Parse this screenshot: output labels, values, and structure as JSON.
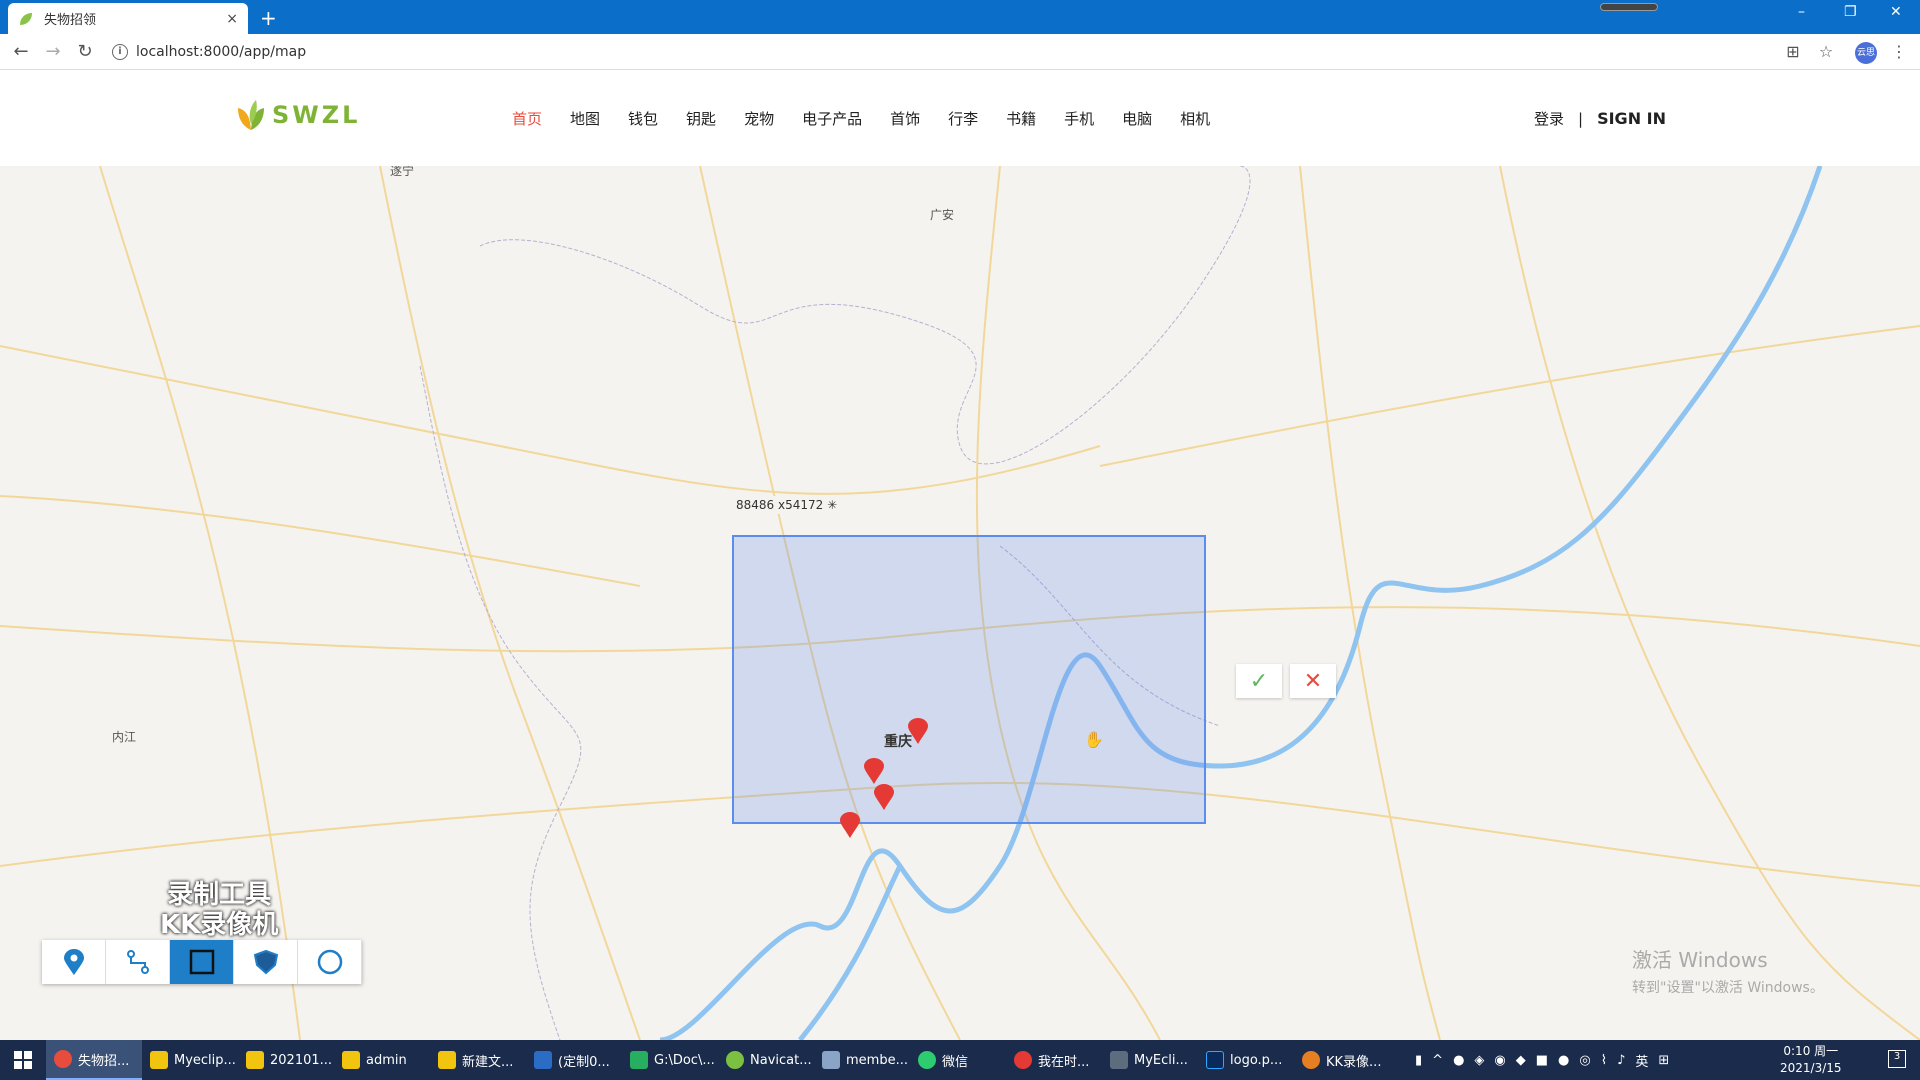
{
  "browser": {
    "tab_title": "失物招领",
    "url": "localhost:8000/app/map",
    "new_tab": "+",
    "tab_close": "×",
    "win_min": "–",
    "win_restore": "❐",
    "win_close": "✕",
    "avatar_text": "云思"
  },
  "site": {
    "logo_text": "SWZL",
    "nav": [
      "首页",
      "地图",
      "钱包",
      "钥匙",
      "宠物",
      "电子产品",
      "首饰",
      "行李",
      "书籍",
      "手机",
      "电脑",
      "相机"
    ],
    "login": "登录",
    "separator": "|",
    "signin": "SIGN IN"
  },
  "map": {
    "cities": [
      "遂宁",
      "广安",
      "内江",
      "重庆"
    ],
    "measure_readout": "88486  x54172  ✳",
    "watermark_line1": "录制工具",
    "watermark_line2": "KK录像机",
    "activation_line1": "激活 Windows",
    "activation_line2": "转到\"设置\"以激活 Windows。",
    "colors": {
      "selection": "#5b8def",
      "marker": "#e53935",
      "river": "#8fc3f0",
      "road": "#f2d79a"
    }
  },
  "draw_tools": [
    {
      "name": "marker-tool",
      "icon": "location-pin-icon"
    },
    {
      "name": "polyline-tool",
      "icon": "route-icon"
    },
    {
      "name": "rectangle-tool",
      "icon": "square-icon"
    },
    {
      "name": "polygon-tool",
      "icon": "shield-icon"
    },
    {
      "name": "circle-tool",
      "icon": "circle-icon"
    }
  ],
  "taskbar": {
    "tasks": [
      "失物招...",
      "Myeclip...",
      "202101...",
      "admin",
      "新建文...",
      "(定制0...",
      "G:\\Doc\\...",
      "Navicat...",
      "membe...",
      "微信",
      "我在时...",
      "MyEcli...",
      "logo.p...",
      "KK录像..."
    ],
    "ime": "英",
    "time": "0:10 周一",
    "date": "2021/3/15",
    "notif": "3"
  }
}
